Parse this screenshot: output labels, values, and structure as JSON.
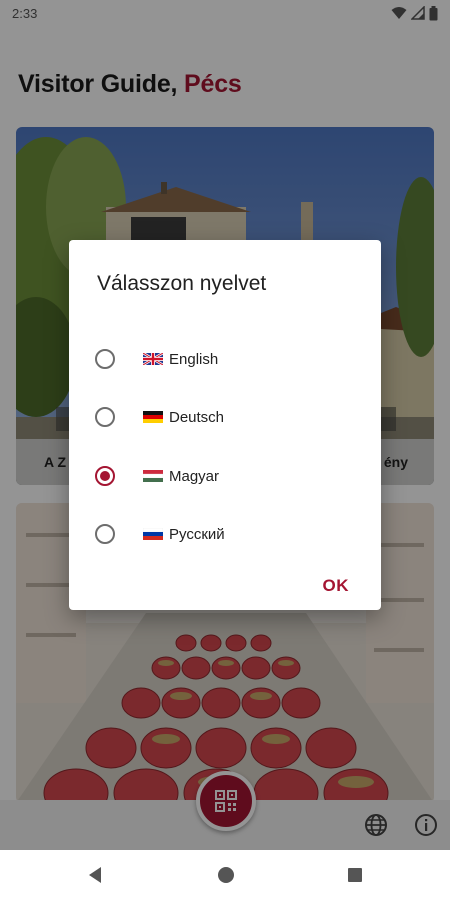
{
  "status_bar": {
    "time": "2:33"
  },
  "app": {
    "title_prefix": "Visitor Guide, ",
    "title_city": "Pécs"
  },
  "cards": [
    {
      "label": "A Z",
      "label_right": "ény"
    },
    {
      "label": ""
    }
  ],
  "dialog": {
    "title": "Válasszon nyelvet",
    "options": [
      {
        "label": "English",
        "checked": false
      },
      {
        "label": "Deutsch",
        "checked": false
      },
      {
        "label": "Magyar",
        "checked": true
      },
      {
        "label": "Русский",
        "checked": false
      }
    ],
    "ok_label": "OK"
  },
  "colors": {
    "accent": "#a41532",
    "scrim": "rgba(0,0,0,0.42)"
  },
  "icons": {
    "status": [
      "wifi-icon",
      "signal-icon",
      "battery-icon"
    ],
    "bottom_bar": [
      "globe-icon",
      "info-icon"
    ],
    "fab": "qr-code-icon",
    "nav": [
      "back-icon",
      "home-icon",
      "recents-icon"
    ]
  }
}
